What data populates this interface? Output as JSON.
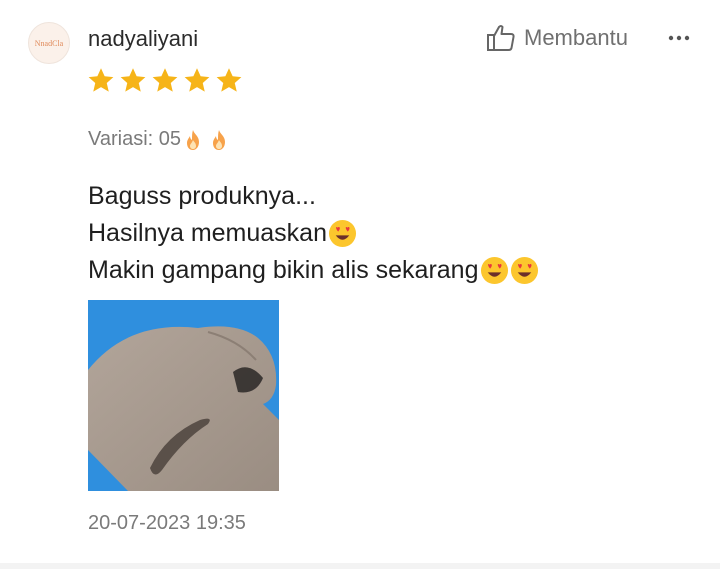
{
  "review": {
    "avatar_text": "NnadCla",
    "username": "nadyaliyani",
    "helpful_label": "Membantu",
    "rating": 5,
    "variant_label": "Variasi: 05",
    "variant_emojis": [
      "fire-icon",
      "fire-icon"
    ],
    "lines": [
      {
        "text": "Baguss produknya...",
        "emojis": []
      },
      {
        "text": "Hasilnya memuaskan",
        "emojis": [
          "heart-eyes-emoji"
        ]
      },
      {
        "text": "Makin gampang bikin alis sekarang",
        "emojis": [
          "heart-eyes-emoji",
          "heart-eyes-emoji"
        ]
      }
    ],
    "date": "20-07-2023 19:35"
  },
  "colors": {
    "star": "#f6b418",
    "muted_text": "#7a7a7a",
    "photo_bg": "#2f8fde",
    "skin": "#a99b90"
  }
}
